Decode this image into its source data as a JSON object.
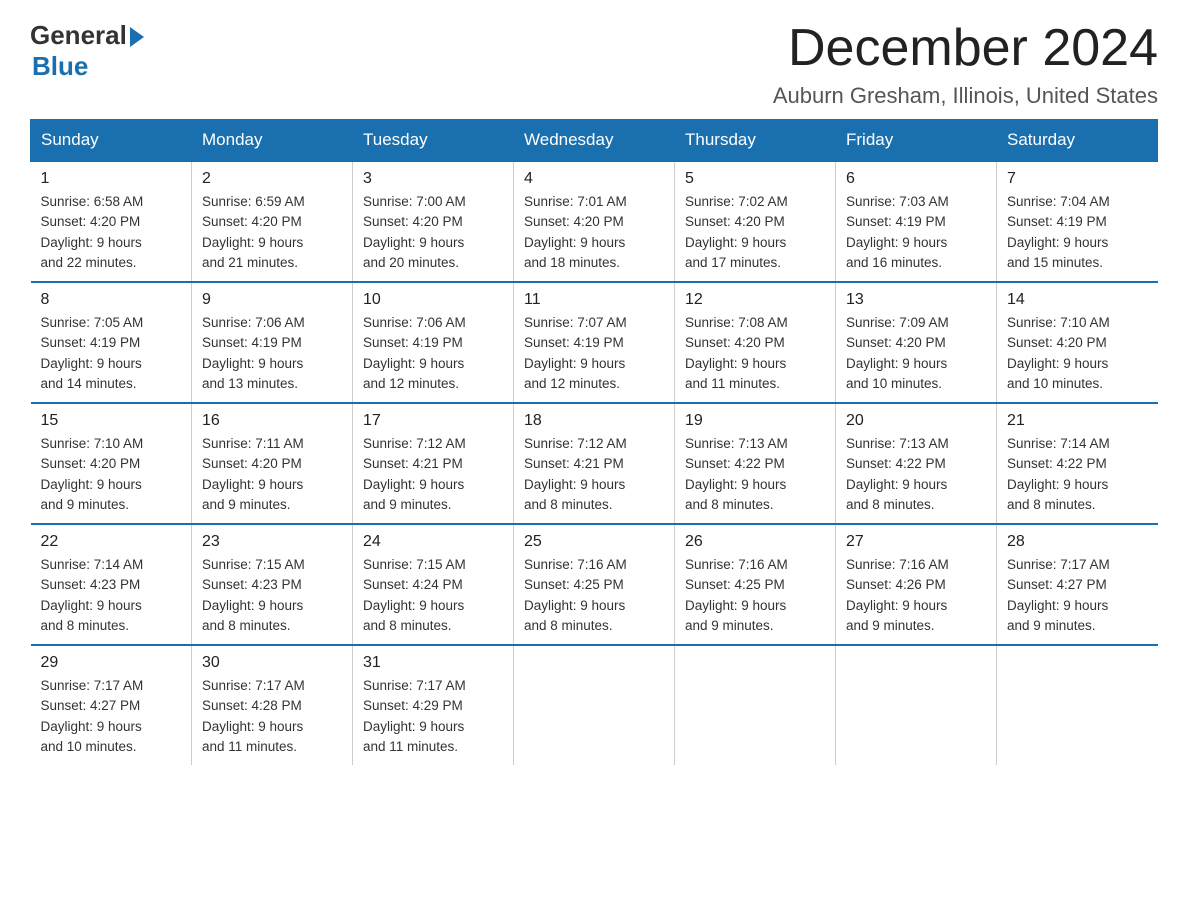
{
  "logo": {
    "general": "General",
    "blue": "Blue"
  },
  "title": "December 2024",
  "subtitle": "Auburn Gresham, Illinois, United States",
  "days_of_week": [
    "Sunday",
    "Monday",
    "Tuesday",
    "Wednesday",
    "Thursday",
    "Friday",
    "Saturday"
  ],
  "weeks": [
    [
      {
        "day": "1",
        "sunrise": "6:58 AM",
        "sunset": "4:20 PM",
        "daylight": "9 hours and 22 minutes."
      },
      {
        "day": "2",
        "sunrise": "6:59 AM",
        "sunset": "4:20 PM",
        "daylight": "9 hours and 21 minutes."
      },
      {
        "day": "3",
        "sunrise": "7:00 AM",
        "sunset": "4:20 PM",
        "daylight": "9 hours and 20 minutes."
      },
      {
        "day": "4",
        "sunrise": "7:01 AM",
        "sunset": "4:20 PM",
        "daylight": "9 hours and 18 minutes."
      },
      {
        "day": "5",
        "sunrise": "7:02 AM",
        "sunset": "4:20 PM",
        "daylight": "9 hours and 17 minutes."
      },
      {
        "day": "6",
        "sunrise": "7:03 AM",
        "sunset": "4:19 PM",
        "daylight": "9 hours and 16 minutes."
      },
      {
        "day": "7",
        "sunrise": "7:04 AM",
        "sunset": "4:19 PM",
        "daylight": "9 hours and 15 minutes."
      }
    ],
    [
      {
        "day": "8",
        "sunrise": "7:05 AM",
        "sunset": "4:19 PM",
        "daylight": "9 hours and 14 minutes."
      },
      {
        "day": "9",
        "sunrise": "7:06 AM",
        "sunset": "4:19 PM",
        "daylight": "9 hours and 13 minutes."
      },
      {
        "day": "10",
        "sunrise": "7:06 AM",
        "sunset": "4:19 PM",
        "daylight": "9 hours and 12 minutes."
      },
      {
        "day": "11",
        "sunrise": "7:07 AM",
        "sunset": "4:19 PM",
        "daylight": "9 hours and 12 minutes."
      },
      {
        "day": "12",
        "sunrise": "7:08 AM",
        "sunset": "4:20 PM",
        "daylight": "9 hours and 11 minutes."
      },
      {
        "day": "13",
        "sunrise": "7:09 AM",
        "sunset": "4:20 PM",
        "daylight": "9 hours and 10 minutes."
      },
      {
        "day": "14",
        "sunrise": "7:10 AM",
        "sunset": "4:20 PM",
        "daylight": "9 hours and 10 minutes."
      }
    ],
    [
      {
        "day": "15",
        "sunrise": "7:10 AM",
        "sunset": "4:20 PM",
        "daylight": "9 hours and 9 minutes."
      },
      {
        "day": "16",
        "sunrise": "7:11 AM",
        "sunset": "4:20 PM",
        "daylight": "9 hours and 9 minutes."
      },
      {
        "day": "17",
        "sunrise": "7:12 AM",
        "sunset": "4:21 PM",
        "daylight": "9 hours and 9 minutes."
      },
      {
        "day": "18",
        "sunrise": "7:12 AM",
        "sunset": "4:21 PM",
        "daylight": "9 hours and 8 minutes."
      },
      {
        "day": "19",
        "sunrise": "7:13 AM",
        "sunset": "4:22 PM",
        "daylight": "9 hours and 8 minutes."
      },
      {
        "day": "20",
        "sunrise": "7:13 AM",
        "sunset": "4:22 PM",
        "daylight": "9 hours and 8 minutes."
      },
      {
        "day": "21",
        "sunrise": "7:14 AM",
        "sunset": "4:22 PM",
        "daylight": "9 hours and 8 minutes."
      }
    ],
    [
      {
        "day": "22",
        "sunrise": "7:14 AM",
        "sunset": "4:23 PM",
        "daylight": "9 hours and 8 minutes."
      },
      {
        "day": "23",
        "sunrise": "7:15 AM",
        "sunset": "4:23 PM",
        "daylight": "9 hours and 8 minutes."
      },
      {
        "day": "24",
        "sunrise": "7:15 AM",
        "sunset": "4:24 PM",
        "daylight": "9 hours and 8 minutes."
      },
      {
        "day": "25",
        "sunrise": "7:16 AM",
        "sunset": "4:25 PM",
        "daylight": "9 hours and 8 minutes."
      },
      {
        "day": "26",
        "sunrise": "7:16 AM",
        "sunset": "4:25 PM",
        "daylight": "9 hours and 9 minutes."
      },
      {
        "day": "27",
        "sunrise": "7:16 AM",
        "sunset": "4:26 PM",
        "daylight": "9 hours and 9 minutes."
      },
      {
        "day": "28",
        "sunrise": "7:17 AM",
        "sunset": "4:27 PM",
        "daylight": "9 hours and 9 minutes."
      }
    ],
    [
      {
        "day": "29",
        "sunrise": "7:17 AM",
        "sunset": "4:27 PM",
        "daylight": "9 hours and 10 minutes."
      },
      {
        "day": "30",
        "sunrise": "7:17 AM",
        "sunset": "4:28 PM",
        "daylight": "9 hours and 11 minutes."
      },
      {
        "day": "31",
        "sunrise": "7:17 AM",
        "sunset": "4:29 PM",
        "daylight": "9 hours and 11 minutes."
      },
      null,
      null,
      null,
      null
    ]
  ],
  "labels": {
    "sunrise": "Sunrise:",
    "sunset": "Sunset:",
    "daylight": "Daylight:"
  },
  "colors": {
    "header_bg": "#1a6faf",
    "header_text": "#ffffff",
    "border": "#1a6faf"
  }
}
